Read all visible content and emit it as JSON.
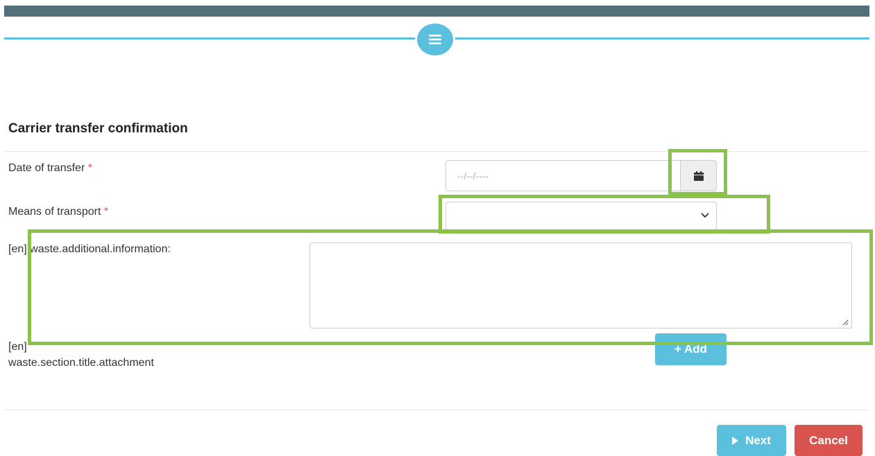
{
  "header": {
    "menu_icon": "hamburger-menu-icon"
  },
  "form": {
    "title": "Carrier transfer confirmation",
    "date_label": "Date of transfer",
    "date_placeholder": "--/--/----",
    "date_value": "",
    "calendar_icon": "calendar-icon",
    "transport_label": "Means of transport",
    "transport_selected": "",
    "info_label": "[en] waste.additional.information:",
    "info_value": "",
    "attachment_label_line1": "[en]",
    "attachment_label_line2": "waste.section.title.attachment",
    "add_label": "Add",
    "required_mark": "*"
  },
  "footer": {
    "next_label": "Next",
    "cancel_label": "Cancel"
  },
  "colors": {
    "accent": "#5bc0de",
    "danger": "#d9534f",
    "topbar": "#546e7a",
    "highlight": "#8bc34a"
  }
}
